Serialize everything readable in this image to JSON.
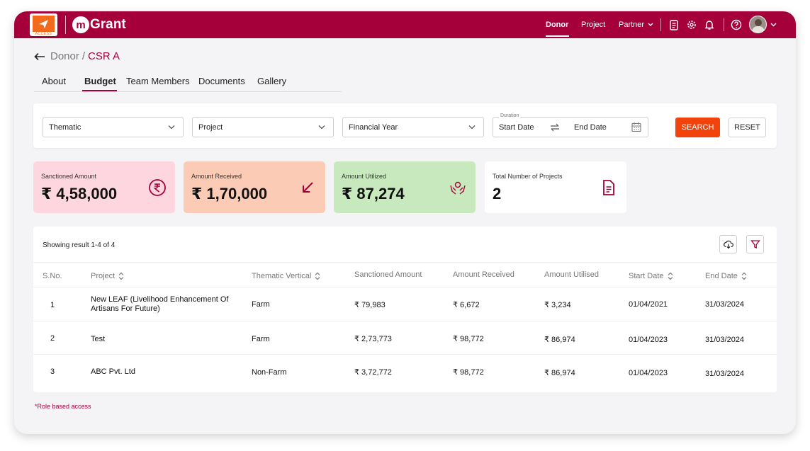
{
  "header": {
    "logo_caption": "ACCESS",
    "brand_mark": "m",
    "brand_name": "Grant",
    "nav": [
      "Donor",
      "Project",
      "Partner"
    ],
    "active_nav": "Donor",
    "colors": {
      "primary": "#a5003a",
      "accent": "#f2430c"
    }
  },
  "breadcrumb": {
    "parent": "Donor",
    "separator": "/",
    "current": "CSR A"
  },
  "tabs": [
    "About",
    "Budget",
    "Team Members",
    "Documents",
    "Gallery"
  ],
  "active_tab": "Budget",
  "filters": {
    "thematic": "Thematic",
    "project": "Project",
    "financial_year": "Financial Year",
    "duration_label": "Duration",
    "start_date": "Start Date",
    "end_date": "End Date",
    "search": "SEARCH",
    "reset": "RESET"
  },
  "stats": [
    {
      "label": "Sanctioned Amount",
      "value": "₹ 4,58,000",
      "icon": "rupee-icon",
      "color": "#fdd6df"
    },
    {
      "label": "Amount Received",
      "value": "₹ 1,70,000",
      "icon": "arrow-down-left-icon",
      "color": "#fccbb5"
    },
    {
      "label": "Amount Utilized",
      "value": "₹ 87,274",
      "icon": "hands-coins-icon",
      "color": "#c8e9be"
    },
    {
      "label": "Total Number of Projects",
      "value": "2",
      "icon": "document-icon",
      "color": "#ffffff"
    }
  ],
  "table": {
    "showing": "Showing result 1-4 of 4",
    "columns": [
      "S.No.",
      "Project",
      "Thematic Vertical",
      "Sanctioned Amount",
      "Amount Received",
      "Amount Utilised",
      "Start Date",
      "End Date"
    ],
    "rows": [
      {
        "sno": "1",
        "project": "New LEAF (Livelihood Enhancement Of Artisans For Future)",
        "thematic": "Farm",
        "sanctioned": "₹ 79,983",
        "received": "₹ 6,672",
        "utilised": "₹ 3,234",
        "start": "01/04/2021",
        "end": "31/03/2024"
      },
      {
        "sno": "2",
        "project": "Test",
        "thematic": "Farm",
        "sanctioned": "₹ 2,73,773",
        "received": "₹ 98,772",
        "utilised": "₹ 86,974",
        "start": "01/04/2023",
        "end": "31/03/2024"
      },
      {
        "sno": "3",
        "project": "ABC Pvt. Ltd",
        "thematic": "Non-Farm",
        "sanctioned": "₹ 3,72,772",
        "received": "₹ 98,772",
        "utilised": "₹ 86,974",
        "start": "01/04/2023",
        "end": "31/03/2024"
      }
    ]
  },
  "footnote": "*Role based access"
}
